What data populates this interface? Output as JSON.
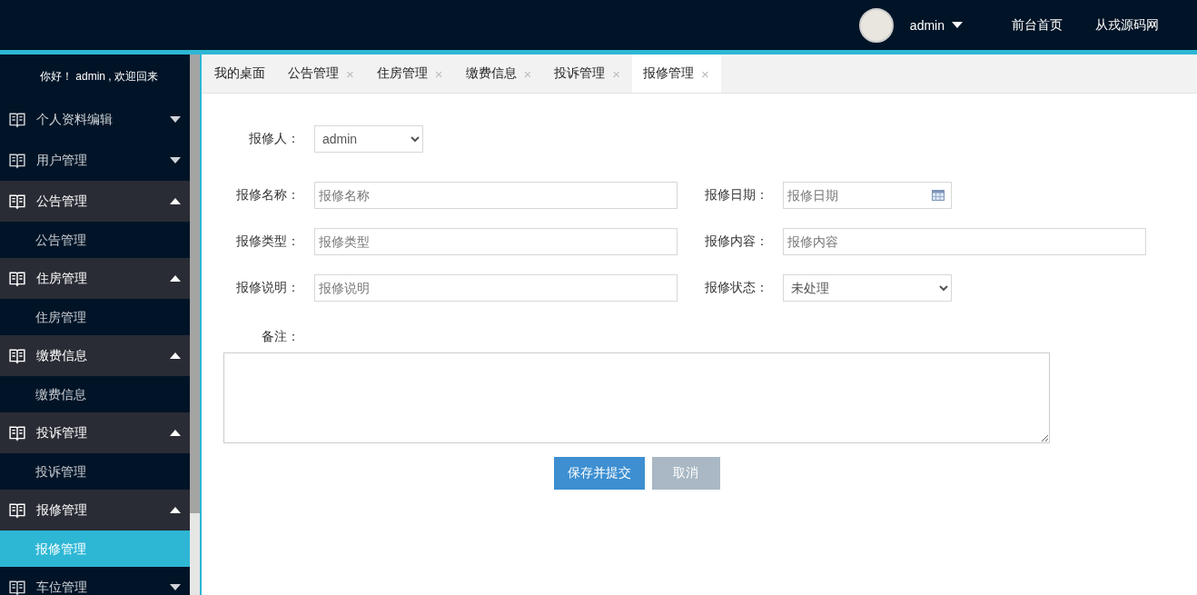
{
  "header": {
    "user": "admin",
    "links": [
      "前台首页",
      "从戎源码网"
    ]
  },
  "sidebar": {
    "greeting": "你好！ admin , 欢迎回来",
    "items": [
      {
        "label": "个人资料编辑",
        "expanded": false
      },
      {
        "label": "用户管理",
        "expanded": false
      },
      {
        "label": "公告管理",
        "expanded": true,
        "children": [
          {
            "label": "公告管理",
            "selected": false
          }
        ]
      },
      {
        "label": "住房管理",
        "expanded": true,
        "children": [
          {
            "label": "住房管理",
            "selected": false
          }
        ]
      },
      {
        "label": "缴费信息",
        "expanded": true,
        "children": [
          {
            "label": "缴费信息",
            "selected": false
          }
        ]
      },
      {
        "label": "投诉管理",
        "expanded": true,
        "children": [
          {
            "label": "投诉管理",
            "selected": false
          }
        ]
      },
      {
        "label": "报修管理",
        "expanded": true,
        "children": [
          {
            "label": "报修管理",
            "selected": true
          }
        ]
      },
      {
        "label": "车位管理",
        "expanded": false
      }
    ]
  },
  "tabs": [
    {
      "label": "我的桌面",
      "selected": false
    },
    {
      "label": "公告管理",
      "close": "×",
      "selected": false
    },
    {
      "label": "住房管理",
      "close": "×",
      "selected": false
    },
    {
      "label": "缴费信息",
      "close": "×",
      "selected": false
    },
    {
      "label": "投诉管理",
      "close": "×",
      "selected": false
    },
    {
      "label": "报修管理",
      "close": "×",
      "selected": true
    }
  ],
  "form": {
    "reporter": {
      "label": "报修人：",
      "value": "admin"
    },
    "fields": [
      {
        "kind": "text",
        "label": "报修名称：",
        "placeholder": "报修名称"
      },
      {
        "kind": "date",
        "label": "报修日期：",
        "placeholder": "报修日期"
      },
      {
        "kind": "text",
        "label": "报修类型：",
        "placeholder": "报修类型"
      },
      {
        "kind": "wide",
        "label": "报修内容：",
        "placeholder": "报修内容"
      },
      {
        "kind": "text",
        "label": "报修说明：",
        "placeholder": "报修说明"
      },
      {
        "kind": "select",
        "label": "报修状态：",
        "value": "未处理"
      }
    ],
    "notes": {
      "label": "备注："
    },
    "buttons": [
      {
        "label": "保存并提交",
        "kind": "primary"
      },
      {
        "label": "取消",
        "kind": "secondary"
      }
    ]
  }
}
